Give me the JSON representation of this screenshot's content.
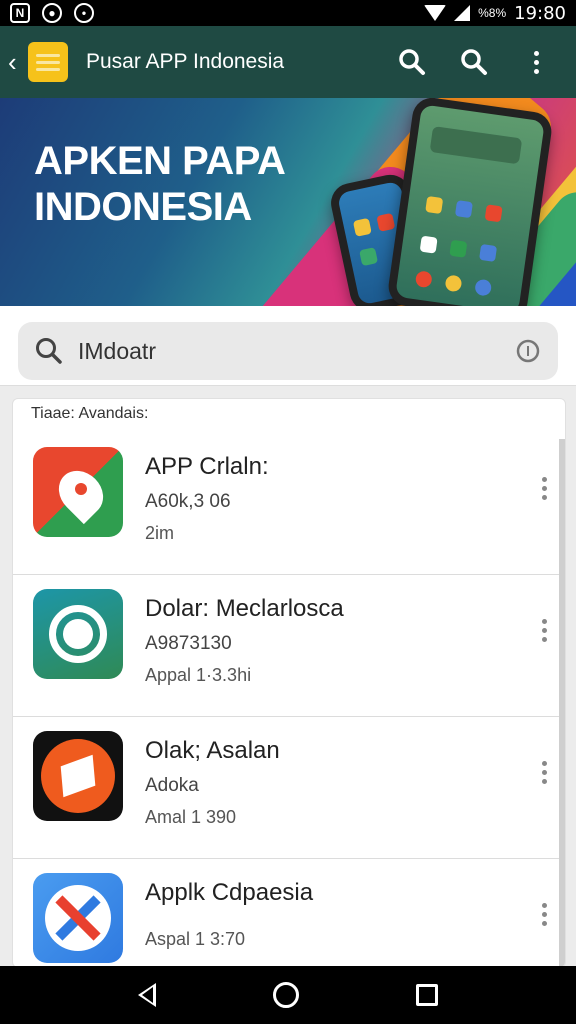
{
  "status_bar": {
    "time": "19:80",
    "battery": "%8%",
    "icons": [
      "n-icon",
      "face-icon",
      "circle-icon",
      "wifi-icon",
      "signal-icon",
      "battery-icon"
    ]
  },
  "app_bar": {
    "title": "Pusar APP Indonesia",
    "icons": [
      "back-icon",
      "app-logo",
      "search-icon",
      "search-icon",
      "more-vert-icon"
    ],
    "color": "#1f4a43"
  },
  "banner": {
    "title_line1": "APKEN PAPA",
    "title_line2": "INDONESIA"
  },
  "search": {
    "value": "IMdoatr",
    "icons": [
      "search-icon",
      "clear-icon"
    ]
  },
  "list": {
    "heading": "Tiaae: Avandais:",
    "items": [
      {
        "name": "APP Crlaln:",
        "subtitle": "A60k,3 06",
        "meta": "2im",
        "icon": "location-pin-icon",
        "icon_colors": [
          "#e8472e",
          "#2f9e4f"
        ]
      },
      {
        "name": "Dolar: Meclarlosca",
        "subtitle": "A9873130",
        "meta": "Appal 1·3.3hi",
        "icon": "chat-bubble-icon",
        "icon_colors": [
          "#1d96a8",
          "#2f8a55"
        ]
      },
      {
        "name": "Olak; Asalan",
        "subtitle": "Adoka",
        "meta": "Amal 1 390",
        "icon": "shape-icon",
        "icon_colors": [
          "#111111",
          "#ef5b1e"
        ]
      },
      {
        "name": "Applk Cdpaesia",
        "subtitle": "",
        "meta": "Aspal 1 3:70",
        "icon": "x-cross-icon",
        "icon_colors": [
          "#2f7ae0",
          "#e8402f"
        ]
      }
    ]
  },
  "nav_bar": {
    "icons": [
      "nav-back-icon",
      "nav-home-icon",
      "nav-recent-icon"
    ]
  }
}
